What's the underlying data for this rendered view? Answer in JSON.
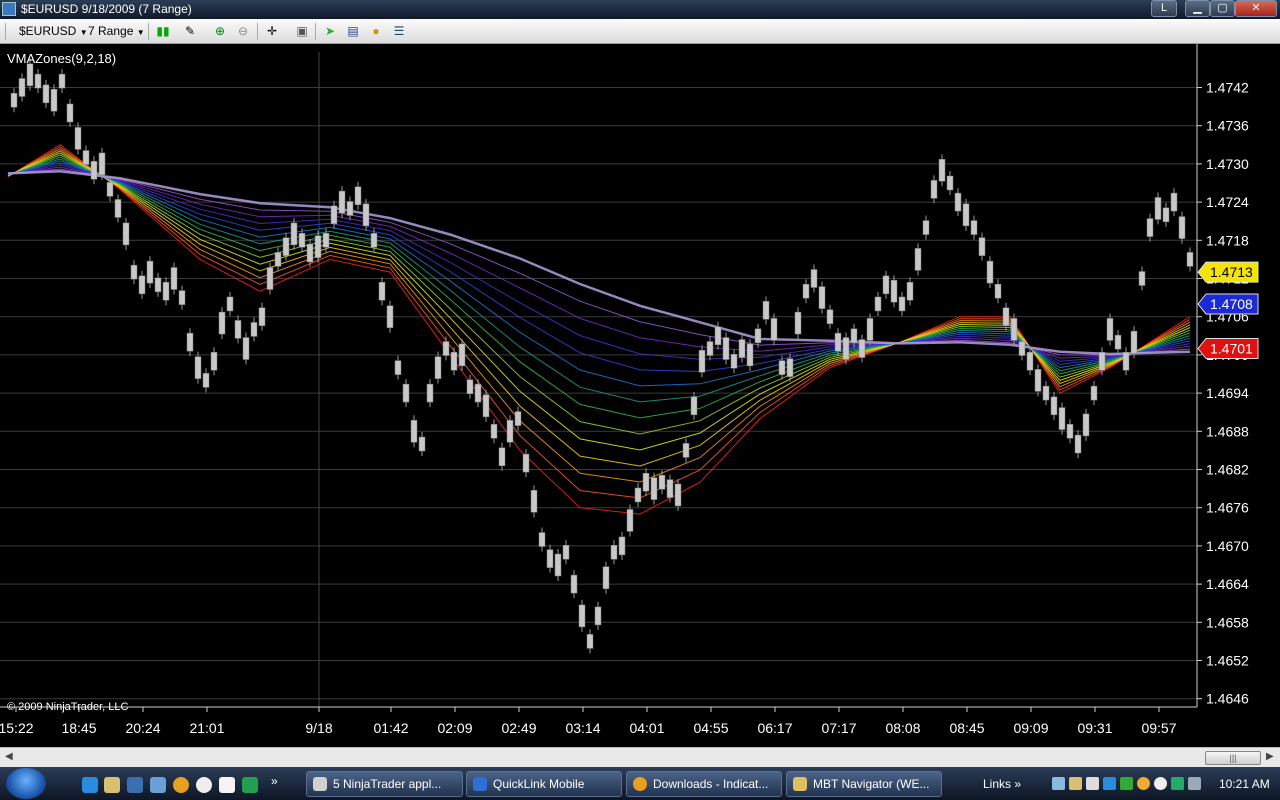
{
  "window": {
    "title": "$EURUSD  9/18/2009 (7 Range)",
    "buttons": {
      "l": "L",
      "minimize": "▁",
      "maximize": "▢",
      "close": "✕"
    }
  },
  "toolbar": {
    "instrument": "$EURUSD",
    "period": "7 Range",
    "icons": [
      "candlestick-icon",
      "pencil-icon",
      "zoom-in-icon",
      "zoom-out-icon",
      "crosshair-icon",
      "snapshot-icon",
      "strategy-icon",
      "indicator-icon",
      "coin-icon",
      "properties-icon"
    ]
  },
  "chart": {
    "indicator_label": "VMAZones(9,2,18)",
    "copyright": "© 2009 NinjaTrader, LLC",
    "price_ticks": [
      "1.4742",
      "1.4736",
      "1.4730",
      "1.4724",
      "1.4718",
      "1.4712",
      "1.4706",
      "1.4700",
      "1.4694",
      "1.4688",
      "1.4682",
      "1.4676",
      "1.4670",
      "1.4664",
      "1.4658",
      "1.4652",
      "1.4646"
    ],
    "time_ticks": [
      "15:22",
      "18:45",
      "20:24",
      "21:01",
      "9/18",
      "01:42",
      "02:09",
      "02:49",
      "03:14",
      "04:01",
      "04:55",
      "06:17",
      "07:17",
      "08:08",
      "08:45",
      "09:09",
      "09:31",
      "09:57"
    ],
    "price_markers": [
      {
        "label": "1.4713",
        "color": "#f5e400",
        "text_color": "#000000"
      },
      {
        "label": "1.4708",
        "color": "#1a2bd6",
        "text_color": "#ffffff"
      },
      {
        "label": "1.4701",
        "color": "#e01010",
        "text_color": "#ffffff"
      }
    ],
    "colors": {
      "background": "#000000",
      "grid": "#3a3a3a",
      "candle": "#c8c8c8",
      "axis_text": "#ffffff"
    }
  },
  "scrollbar": {
    "left_arrow": "◀",
    "right_arrow": "▶",
    "thumb_grip": "|||"
  },
  "taskbar": {
    "tasks": [
      {
        "label": "5 NinjaTrader appl...",
        "icon_color": "#d0d0d0"
      },
      {
        "label": "QuickLink Mobile",
        "icon_color": "#2f6fd6"
      },
      {
        "label": "Downloads - Indicat...",
        "icon_color": "#e8a020"
      },
      {
        "label": "MBT Navigator (WE...",
        "icon_color": "#e0c060"
      }
    ],
    "links": "Links",
    "clock": "10:21 AM"
  }
}
